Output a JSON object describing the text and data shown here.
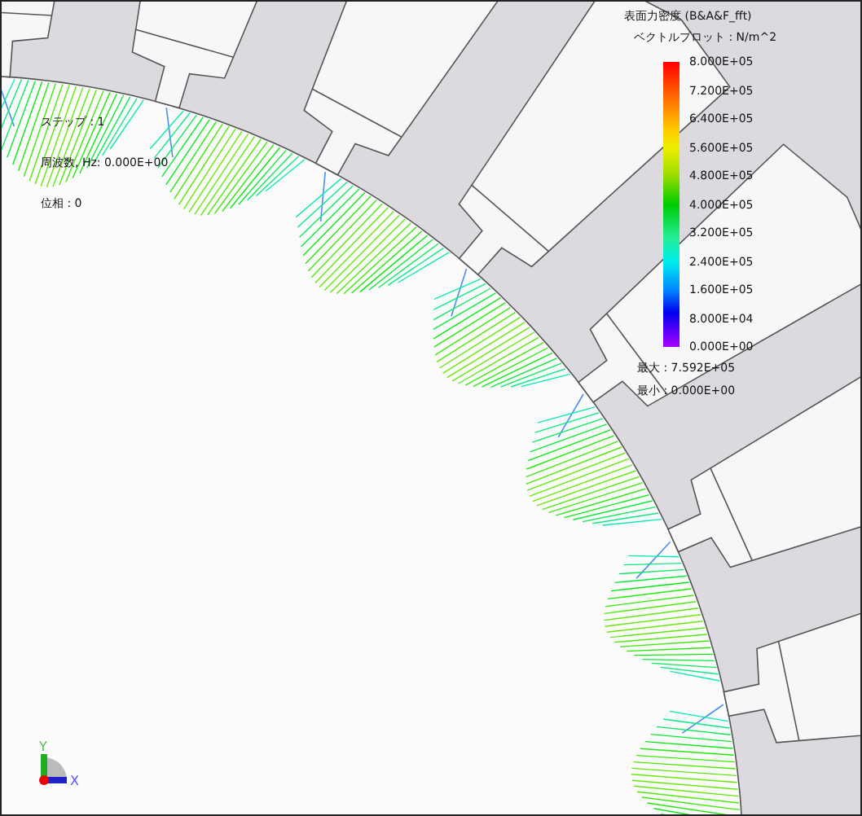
{
  "legend": {
    "title": "表面力密度 (B&A&F_fft)",
    "subtitle": "ベクトルプロット : N/m^2",
    "labels": [
      "8.000E+05",
      "7.200E+05",
      "6.400E+05",
      "5.600E+05",
      "4.800E+05",
      "4.000E+05",
      "3.200E+05",
      "2.400E+05",
      "1.600E+05",
      "8.000E+04",
      "0.000E+00"
    ],
    "max": "最大 : 7.592E+05",
    "min": "最小 : 0.000E+00"
  },
  "info": [
    "ステップ : 1",
    "周波数, Hz: 0.000E+00",
    "位相 : 0"
  ],
  "axes": {
    "x": "X",
    "y": "Y"
  }
}
